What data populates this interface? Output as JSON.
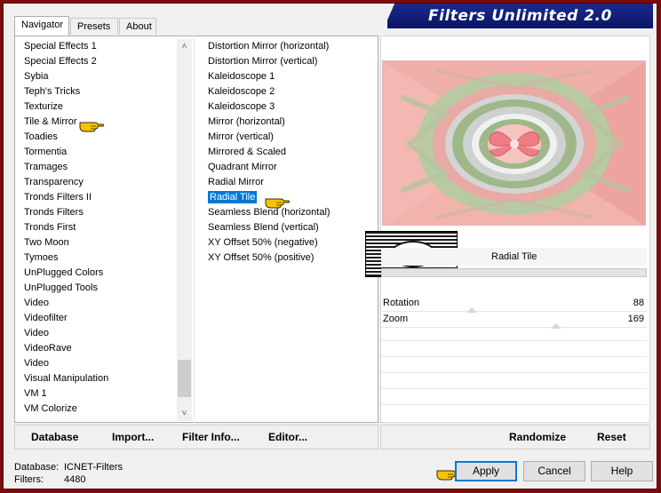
{
  "title": "Filters Unlimited 2.0",
  "tabs": [
    "Navigator",
    "Presets",
    "About"
  ],
  "categories": [
    "Special Effects 1",
    "Special Effects 2",
    "Sybia",
    "Teph's Tricks",
    "Texturize",
    "Tile & Mirror",
    "Toadies",
    "Tormentia",
    "Tramages",
    "Transparency",
    "Tronds Filters II",
    "Tronds Filters",
    "Tronds First",
    "Two Moon",
    "Tymoes",
    "UnPlugged Colors",
    "UnPlugged Tools",
    "Video",
    "Videofilter",
    "Video",
    "VideoRave",
    "Video",
    "Visual Manipulation",
    "VM 1",
    "VM Colorize"
  ],
  "selected_category": "Tile & Mirror",
  "filters": [
    "Distortion Mirror (horizontal)",
    "Distortion Mirror (vertical)",
    "Kaleidoscope 1",
    "Kaleidoscope 2",
    "Kaleidoscope 3",
    "Mirror (horizontal)",
    "Mirror (vertical)",
    "Mirrored & Scaled",
    "Quadrant Mirror",
    "Radial Mirror",
    "Radial Tile",
    "Seamless Blend (horizontal)",
    "Seamless Blend (vertical)",
    "XY Offset 50% (negative)",
    "XY Offset 50% (positive)"
  ],
  "selected_filter": "Radial Tile",
  "bottom_bar": {
    "database": "Database",
    "import": "Import...",
    "filter_info": "Filter Info...",
    "editor": "Editor..."
  },
  "right_bar": {
    "randomize": "Randomize",
    "reset": "Reset"
  },
  "logo_text": "claudia",
  "filter_name": "Radial Tile",
  "params": [
    {
      "label": "Rotation",
      "value": "88"
    },
    {
      "label": "Zoom",
      "value": "169"
    }
  ],
  "info": {
    "database_label": "Database:",
    "database_value": "ICNET-Filters",
    "filters_label": "Filters:",
    "filters_value": "4480"
  },
  "buttons": {
    "apply": "Apply",
    "cancel": "Cancel",
    "help": "Help"
  },
  "colors": {
    "title_bar": "#0c1566",
    "selection": "#0078d7",
    "frame": "#7a0c0c",
    "pointer_hand": "#f5c400"
  },
  "icons": [
    "pointing-hand-icon",
    "scroll-up-arrow-icon",
    "scroll-down-arrow-icon"
  ]
}
